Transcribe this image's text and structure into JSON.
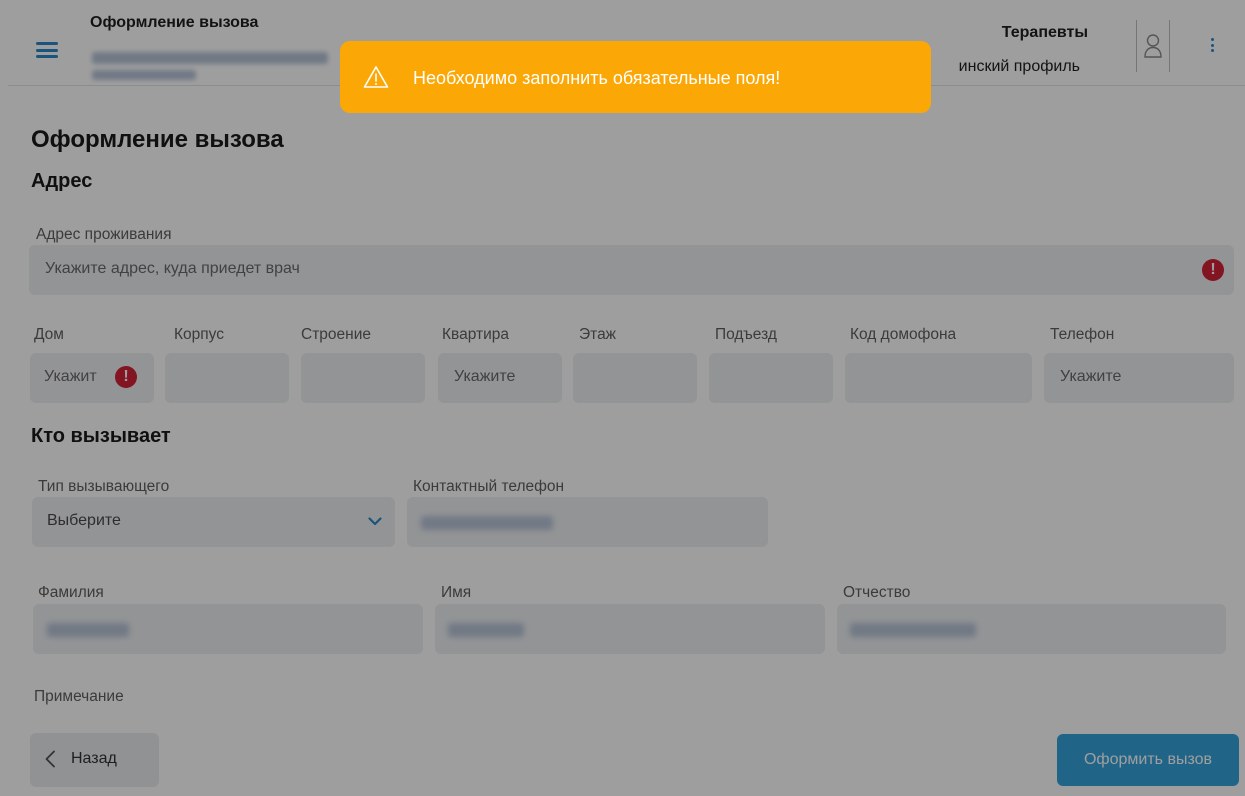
{
  "header": {
    "title": "Оформление вызова",
    "right_title": "Терапевты",
    "right_subtitle": "инский профиль"
  },
  "page": {
    "title": "Оформление вызова"
  },
  "address": {
    "section_title": "Адрес",
    "residence_label": "Адрес проживания",
    "residence_placeholder": "Укажите адрес, куда приедет врач",
    "fields": [
      {
        "label": "Дом",
        "placeholder": "Укажит"
      },
      {
        "label": "Корпус",
        "placeholder": ""
      },
      {
        "label": "Строение",
        "placeholder": ""
      },
      {
        "label": "Квартира",
        "placeholder": "Укажите"
      },
      {
        "label": "Этаж",
        "placeholder": ""
      },
      {
        "label": "Подъезд",
        "placeholder": ""
      },
      {
        "label": "Код домофона",
        "placeholder": ""
      },
      {
        "label": "Телефон",
        "placeholder": "Укажите"
      }
    ]
  },
  "caller": {
    "section_title": "Кто вызывает",
    "type_label": "Тип вызывающего",
    "type_value": "Выберите",
    "contact_phone_label": "Контактный телефон",
    "last_name_label": "Фамилия",
    "first_name_label": "Имя",
    "middle_name_label": "Отчество",
    "note_label": "Примечание"
  },
  "buttons": {
    "back": "Назад",
    "submit": "Оформить вызов"
  },
  "toast": {
    "message": "Необходимо заполнить обязательные поля!"
  },
  "colors": {
    "accent": "#2a88c9",
    "toast": "#fba806",
    "error": "#d42138",
    "submit": "#35a3db"
  }
}
